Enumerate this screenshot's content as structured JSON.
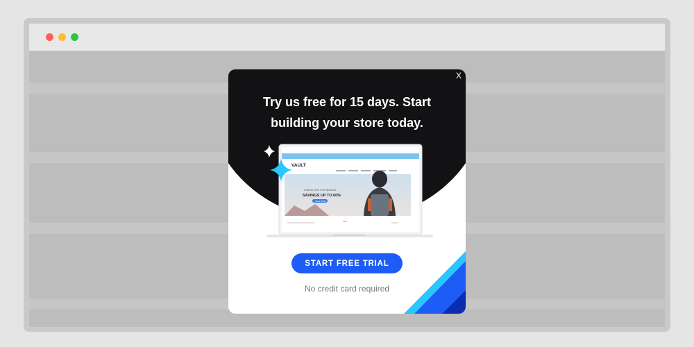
{
  "window": {
    "traffic_lights": [
      "#ff5f57",
      "#febc2e",
      "#28c840"
    ]
  },
  "popup": {
    "close_label": "X",
    "headline_line1": "Try us free for 15 days. Start",
    "headline_line2": "building your store today.",
    "cta_label": "START FREE TRIAL",
    "fine_print": "No credit card required",
    "colors": {
      "dark": "#121214",
      "accent": "#1d5cf5",
      "cyan": "#29c6ff"
    }
  },
  "preview": {
    "logo": "VAULT",
    "hero_small": "A NEW LOOK THIS SEASON",
    "hero_title": "SAVINGS UP TO 60%",
    "hero_button": "SHOP NOW"
  }
}
